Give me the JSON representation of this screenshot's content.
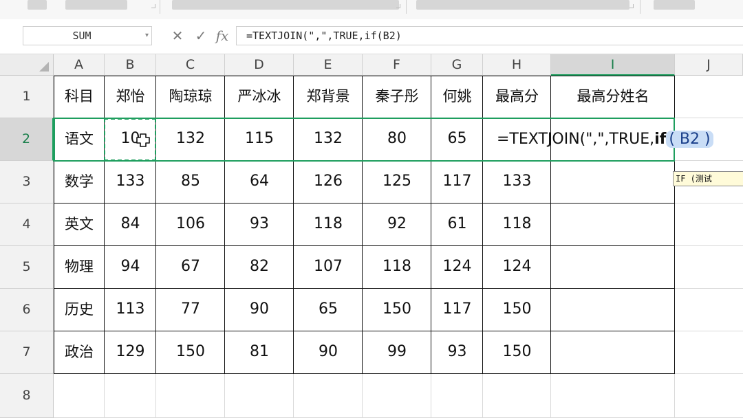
{
  "name_box": {
    "value": "SUM"
  },
  "formula_bar": {
    "cancel_icon": "✕",
    "enter_icon": "✓",
    "fx_label": "fx",
    "content": "=TEXTJOIN(\",\",TRUE,if(B2)"
  },
  "columns": [
    "A",
    "B",
    "C",
    "D",
    "E",
    "F",
    "G",
    "H",
    "I",
    "J"
  ],
  "rows": [
    "1",
    "2",
    "3",
    "4",
    "5",
    "6",
    "7",
    "8"
  ],
  "table": {
    "header": [
      "科目",
      "郑怡",
      "陶琼琼",
      "严冰冰",
      "郑背景",
      "秦子彤",
      "何姚",
      "最高分",
      "最高分姓名"
    ],
    "rows": [
      [
        "语文",
        "10",
        "132",
        "115",
        "132",
        "80",
        "65"
      ],
      [
        "数学",
        "133",
        "85",
        "64",
        "126",
        "125",
        "117",
        "133"
      ],
      [
        "英文",
        "84",
        "106",
        "93",
        "118",
        "92",
        "61",
        "118"
      ],
      [
        "物理",
        "94",
        "67",
        "82",
        "107",
        "118",
        "124",
        "124"
      ],
      [
        "历史",
        "113",
        "77",
        "90",
        "65",
        "150",
        "117",
        "150"
      ],
      [
        "政治",
        "129",
        "150",
        "81",
        "90",
        "99",
        "93",
        "150"
      ]
    ]
  },
  "active_cell": {
    "ref": "I2",
    "formula_prefix": "=TEXTJOIN(\",\",TRUE,",
    "formula_fn": "if",
    "formula_open": "(",
    "formula_ref": "B2",
    "formula_close": ")"
  },
  "tooltip": {
    "text": "IF (测试"
  },
  "colors": {
    "accent": "#1e9e5e",
    "ref_highlight": "#c9ddf6",
    "header_bg": "#f2f2f2",
    "tooltip_bg": "#fffbd9"
  }
}
